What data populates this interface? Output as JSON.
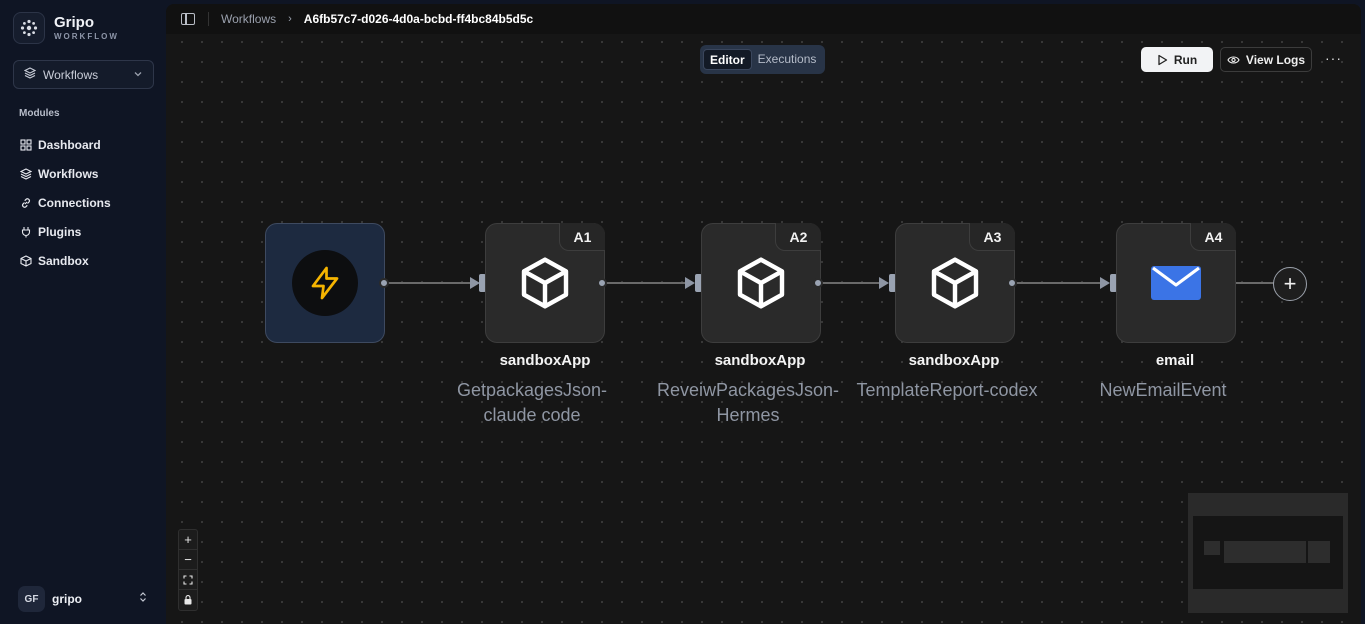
{
  "brand": {
    "name": "Gripo",
    "sub": "WORKFLOW"
  },
  "sidebar": {
    "selector_label": "Workflows",
    "modules_heading": "Modules",
    "items": [
      {
        "label": "Dashboard",
        "icon": "grid-icon"
      },
      {
        "label": "Workflows",
        "icon": "layers-icon"
      },
      {
        "label": "Connections",
        "icon": "link-icon"
      },
      {
        "label": "Plugins",
        "icon": "plug-icon"
      },
      {
        "label": "Sandbox",
        "icon": "box-icon"
      }
    ],
    "user": {
      "initials": "GF",
      "name": "gripo"
    }
  },
  "topbar": {
    "breadcrumb_parent": "Workflows",
    "breadcrumb_current": "A6fb57c7-d026-4d0a-bcbd-ff4bc84b5d5c"
  },
  "tabs": {
    "editor": "Editor",
    "executions": "Executions",
    "active": "Editor"
  },
  "actions": {
    "run": "Run",
    "view_logs": "View Logs",
    "more": "···"
  },
  "nodes": [
    {
      "badge": "",
      "type": "trigger",
      "title": "",
      "subtitle": ""
    },
    {
      "badge": "A1",
      "type": "sandbox",
      "title": "sandboxApp",
      "subtitle": "GetpackagesJson-claude code"
    },
    {
      "badge": "A2",
      "type": "sandbox",
      "title": "sandboxApp",
      "subtitle": "ReveiwPackagesJson-Hermes"
    },
    {
      "badge": "A3",
      "type": "sandbox",
      "title": "sandboxApp",
      "subtitle": "TemplateReport-codex"
    },
    {
      "badge": "A4",
      "type": "email",
      "title": "email",
      "subtitle": "NewEmailEvent"
    }
  ],
  "colors": {
    "accent_bolt": "#f5b400",
    "email_blue": "#3b74e6",
    "canvas": "#161616",
    "sidebar": "#0f1524"
  },
  "zoom_controls": [
    "+",
    "−",
    "⛶",
    "🔒"
  ]
}
